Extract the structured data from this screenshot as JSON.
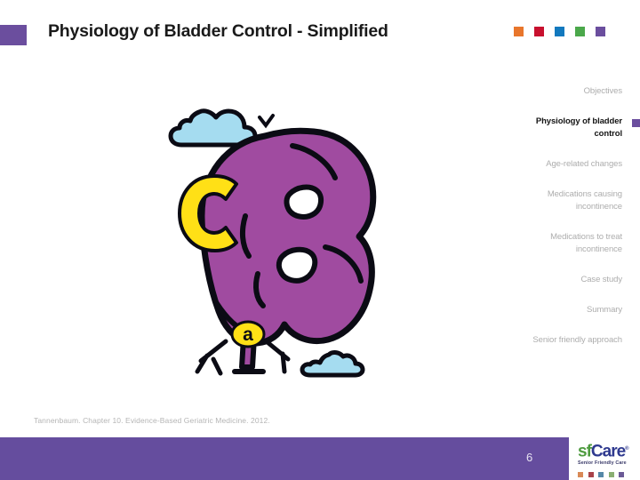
{
  "slide": {
    "title": "Physiology of Bladder Control - Simplified",
    "page_number": "6",
    "citation": "Tannenbaum. Chapter 10. Evidence-Based Geriatric Medicine. 2012."
  },
  "header": {
    "accent_square_color": "#6B4E9E",
    "chips": [
      {
        "name": "chip-orange",
        "color": "#E8762C"
      },
      {
        "name": "chip-red",
        "color": "#C8102E"
      },
      {
        "name": "chip-blue",
        "color": "#1279BE"
      },
      {
        "name": "chip-green",
        "color": "#4BA84B"
      },
      {
        "name": "chip-purple",
        "color": "#6B4E9E"
      }
    ]
  },
  "nav": {
    "items": [
      {
        "label": "Objectives",
        "active": false
      },
      {
        "label": "Physiology of bladder control",
        "active": true
      },
      {
        "label": "Age-related changes",
        "active": false
      },
      {
        "label": "Medications causing incontinence",
        "active": false
      },
      {
        "label": "Medications to treat incontinence",
        "active": false
      },
      {
        "label": "Case study",
        "active": false
      },
      {
        "label": "Summary",
        "active": false
      },
      {
        "label": "Senior friendly approach",
        "active": false
      }
    ],
    "active_color": "#141414",
    "inactive_color": "#ADADAD",
    "marker_color": "#6B4E9E"
  },
  "illustration": {
    "name": "cartoon-bladder-balloon",
    "description": "Hand-drawn purple balloon-shaped bladder with yellow letter C on the left, yellow letter a at the neck, blue clouds and a bird",
    "letter_c": "C",
    "letter_a": "a",
    "colors": {
      "balloon": "#A04BA0",
      "letters": "#FFE016",
      "cloud": "#A5DCF0",
      "outline": "#0B0B14",
      "highlight": "#FFFFFF"
    }
  },
  "footer": {
    "bar_color": "#654D9E",
    "logo": {
      "sf": "sf",
      "care": "Care",
      "tm": "®",
      "tagline": "Senior Friendly Care",
      "chips": [
        {
          "name": "logo-chip-orange",
          "color": "#D98A57"
        },
        {
          "name": "logo-chip-red",
          "color": "#A8434A"
        },
        {
          "name": "logo-chip-blue",
          "color": "#5588A8"
        },
        {
          "name": "logo-chip-green",
          "color": "#8AAE72"
        },
        {
          "name": "logo-chip-purple",
          "color": "#6B5A96"
        }
      ]
    }
  }
}
